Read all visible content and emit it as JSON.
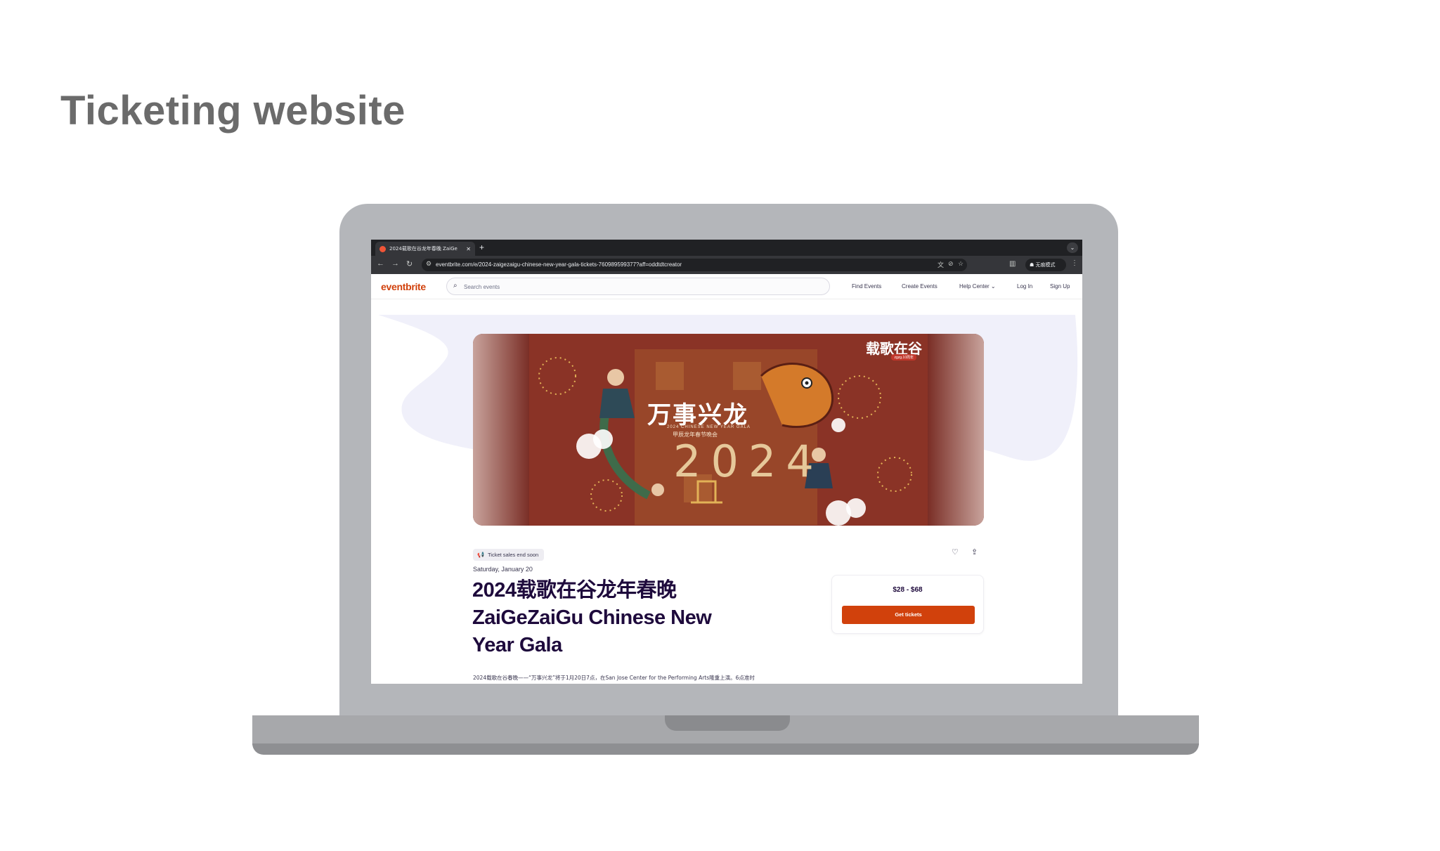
{
  "slide": {
    "title": "Ticketing website"
  },
  "browser": {
    "tab_title": "2024载歌在谷龙年春晚 ZaiGe",
    "tab_close": "✕",
    "new_tab": "+",
    "url": "eventbrite.com/e/2024-zaigezaigu-chinese-new-year-gala-tickets-760989599377?aff=oddtdtcreator",
    "incognito_label": "无痕模式"
  },
  "site": {
    "logo": "eventbrite",
    "search_placeholder": "Search events",
    "nav": {
      "find_events": "Find Events",
      "create_events": "Create Events",
      "help_center": "Help Center",
      "log_in": "Log In",
      "sign_up": "Sign Up"
    }
  },
  "poster": {
    "title": "万事兴龙",
    "subtitle_en": "2024 CHINESE NEW YEAR GALA",
    "subtitle_cn": "甲辰龙年春节晚会",
    "year": "2024",
    "brand": "载歌在谷",
    "brand_sub": "zgzg.10周年"
  },
  "event": {
    "badge": "Ticket sales end soon",
    "date": "Saturday, January 20",
    "title": "2024载歌在谷龙年春晚 ZaiGeZaiGu Chinese New Year Gala",
    "description": "2024载歌在谷春晚——“万事兴龙”将于1月20日7点，在San Jose Center for the Performing Arts隆重上演。6点准时"
  },
  "ticket": {
    "price": "$28 - $68",
    "button": "Get tickets"
  },
  "icons": [
    "favicon-icon",
    "back-icon",
    "forward-icon",
    "reload-icon",
    "site-info-icon",
    "translate-icon",
    "eye-off-icon",
    "star-icon",
    "sidepanel-icon",
    "incognito-icon",
    "menu-icon",
    "search-icon",
    "chevron-down-icon",
    "megaphone-icon",
    "heart-icon",
    "share-icon"
  ],
  "colors": {
    "brand": "#d1410c",
    "title": "#1e0a3c",
    "hero_bg": "#f0f0fa"
  }
}
